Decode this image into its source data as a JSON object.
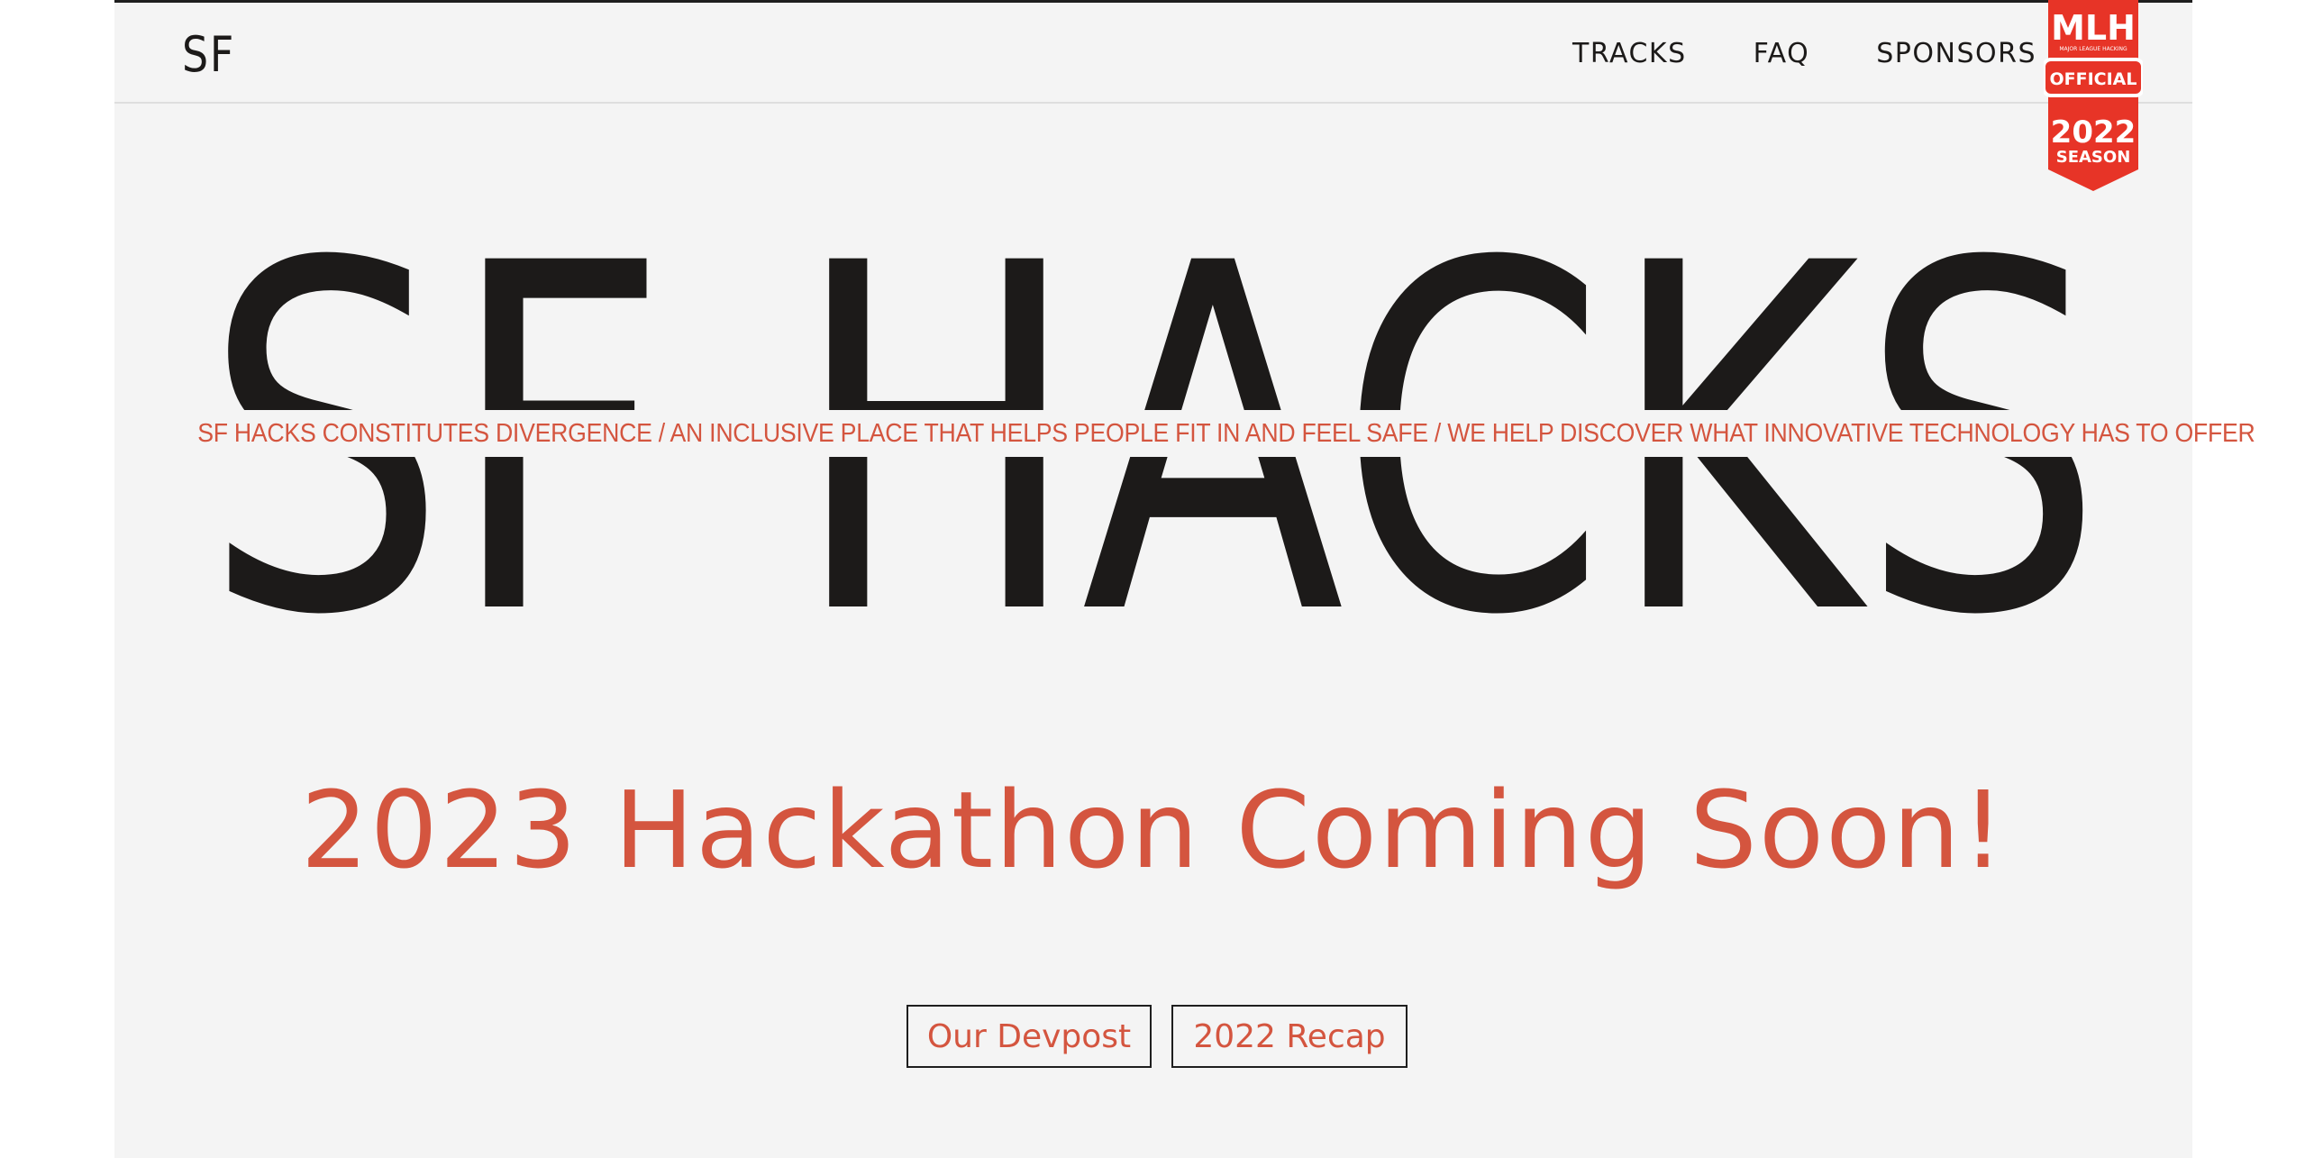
{
  "header": {
    "logo_text": "SF",
    "nav": [
      {
        "label": "TRACKS"
      },
      {
        "label": "FAQ"
      },
      {
        "label": "SPONSORS"
      }
    ],
    "badge": {
      "org": "MLH",
      "sub": "MAJOR LEAGUE HACKING",
      "official": "OFFICIAL",
      "year": "2022",
      "season": "SEASON",
      "color": "#e73427"
    }
  },
  "hero": {
    "title": "SF HACKS",
    "tagline": "SF HACKS CONSTITUTES DIVERGENCE / AN INCLUSIVE PLACE THAT HELPS PEOPLE FIT IN AND FEEL SAFE / WE HELP DISCOVER WHAT INNOVATIVE TECHNOLOGY HAS TO OFFER",
    "headline": "2023 Hackathon Coming Soon!",
    "buttons": [
      {
        "label": "Our Devpost"
      },
      {
        "label": "2022 Recap"
      }
    ]
  },
  "colors": {
    "background": "#f4f4f4",
    "ink": "#1c1a19",
    "accent": "#d4553f"
  }
}
